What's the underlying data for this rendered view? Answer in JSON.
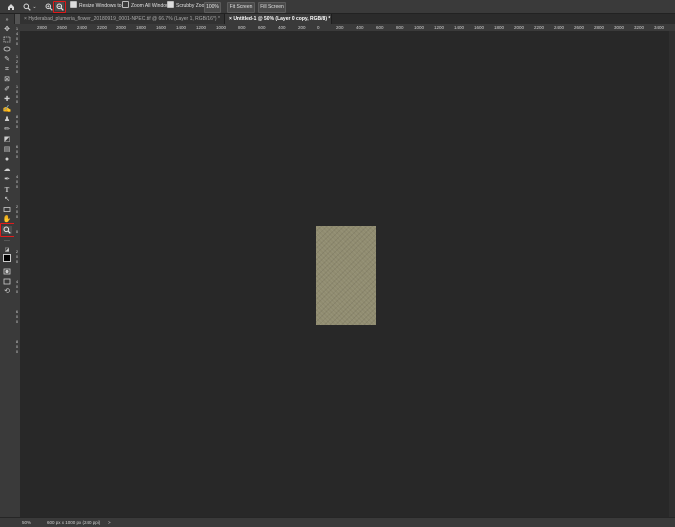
{
  "options_bar": {
    "resize_windows_label": "Resize Windows to Fit",
    "zoom_all_windows_label": "Zoom All Windows",
    "scrubby_zoom_label": "Scrubby Zoom",
    "zoom_value": "100%",
    "fit_screen_label": "Fit Screen",
    "fill_screen_label": "Fill Screen"
  },
  "tabs": [
    {
      "label": "Hyderabad_plumeria_flower_20180919_0001-NPEC.tif @ 66.7% (Layer 1, RGB/16*) *",
      "close": "×",
      "active": false
    },
    {
      "label": "Untitled-1 @ 50% (Layer 0 copy, RGB/8) *",
      "close": "×",
      "active": true
    }
  ],
  "rulers": {
    "horizontal": [
      "2800",
      "2600",
      "2400",
      "2200",
      "2000",
      "1800",
      "1600",
      "1400",
      "1200",
      "1000",
      "800",
      "600",
      "400",
      "200",
      "0",
      "200",
      "400",
      "600",
      "800",
      "1000",
      "1200",
      "1400",
      "1600",
      "1800",
      "2000",
      "2200",
      "2400",
      "2600",
      "2800",
      "3000",
      "3200",
      "3400"
    ],
    "vertical": [
      "1",
      "4",
      "0",
      "0",
      "1",
      "2",
      "0",
      "0",
      "1",
      "0",
      "0",
      "0",
      "8",
      "0",
      "0",
      "6",
      "0",
      "0",
      "4",
      "0",
      "0",
      "2",
      "0",
      "0",
      "0",
      "2",
      "0",
      "0",
      "4",
      "0",
      "0",
      "6",
      "0",
      "0",
      "8",
      "0",
      "0"
    ]
  },
  "status": {
    "zoom": "50%",
    "doc_size": "600 px x 1000 px (240 ppi)",
    "arrow": ">"
  },
  "colors": {
    "accent_highlight": "#e01b1b",
    "canvas_bg": "#282828",
    "document_fill": "#908c70"
  }
}
